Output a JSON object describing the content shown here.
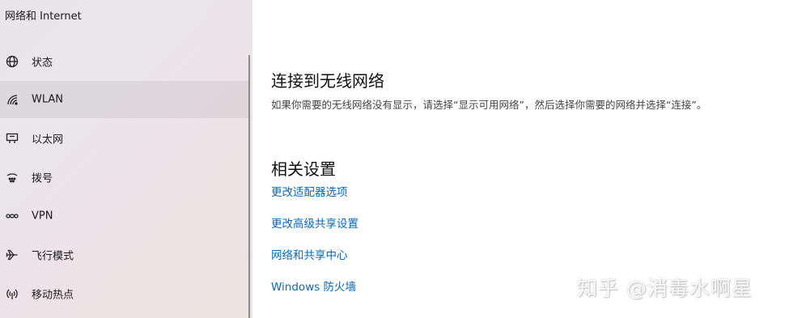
{
  "sidebar": {
    "title": "网络和 Internet",
    "items": [
      {
        "label": "状态",
        "icon": "globe-icon"
      },
      {
        "label": "WLAN",
        "icon": "wifi-icon",
        "selected": true
      },
      {
        "label": "以太网",
        "icon": "ethernet-icon"
      },
      {
        "label": "拨号",
        "icon": "dialup-icon"
      },
      {
        "label": "VPN",
        "icon": "vpn-icon"
      },
      {
        "label": "飞行模式",
        "icon": "airplane-icon"
      },
      {
        "label": "移动热点",
        "icon": "hotspot-icon"
      }
    ]
  },
  "main": {
    "heading": "连接到无线网络",
    "description": "如果你需要的无线网络没有显示，请选择“显示可用网络”，然后选择你需要的网络并选择“连接”。",
    "related_heading": "相关设置",
    "links": [
      {
        "label": "更改适配器选项"
      },
      {
        "label": "更改高级共享设置"
      },
      {
        "label": "网络和共享中心"
      },
      {
        "label": "Windows 防火墙"
      }
    ]
  },
  "watermark": "知乎 @消毒水啊星",
  "colors": {
    "link": "#0a68b4",
    "selected_bg": "rgba(0,0,0,0.06)"
  }
}
